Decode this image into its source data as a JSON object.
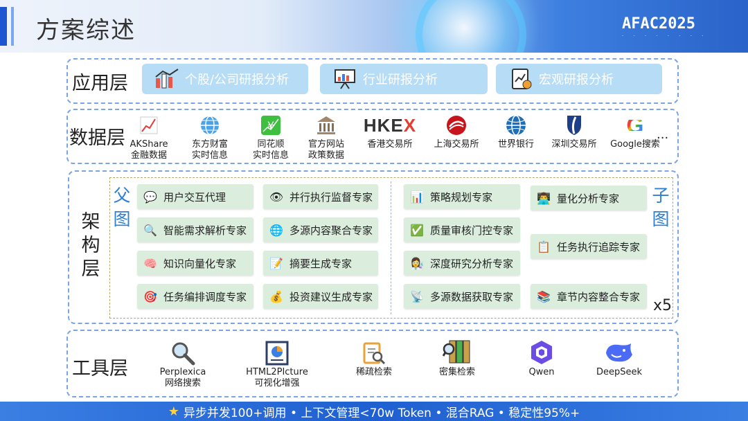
{
  "header": {
    "title": "方案综述",
    "logo": "AFAC2025"
  },
  "app_layer": {
    "label": "应用层",
    "items": [
      {
        "label": "个股/公司研报分析",
        "icon": "chart-building-icon"
      },
      {
        "label": "行业研报分析",
        "icon": "presentation-board-icon"
      },
      {
        "label": "宏观研报分析",
        "icon": "macro-report-icon"
      }
    ]
  },
  "data_layer": {
    "label": "数据层",
    "sources": [
      {
        "line1": "AKShare",
        "line2": "金融数据",
        "icon": "line-chart-icon"
      },
      {
        "line1": "东方财富",
        "line2": "实时信息",
        "icon": "globe-icon"
      },
      {
        "line1": "同花顺",
        "line2": "实时信息",
        "icon": "yen-chart-icon"
      },
      {
        "line1": "官方网站",
        "line2": "政策数据",
        "icon": "bank-building-icon"
      },
      {
        "line1": "香港交易所",
        "line2": "",
        "logo_text": "HKE",
        "logo_x": "X",
        "icon": "hkex-logo"
      },
      {
        "line1": "上海交易所",
        "line2": "",
        "icon": "sse-logo"
      },
      {
        "line1": "世界银行",
        "line2": "",
        "icon": "world-bank-logo"
      },
      {
        "line1": "深圳交易所",
        "line2": "",
        "icon": "szse-logo"
      },
      {
        "line1": "Google搜索",
        "line2": "",
        "logo_text": "G",
        "icon": "google-logo"
      }
    ],
    "more": "..."
  },
  "arch_layer": {
    "label_chars": [
      "架",
      "构",
      "层"
    ],
    "parent_chars": [
      "父",
      "图"
    ],
    "child_chars": [
      "子",
      "图"
    ],
    "multiplier": "x5",
    "parent_agents": [
      {
        "label": "用户交互代理",
        "icon": "speech-bubble-icon"
      },
      {
        "label": "并行执行监督专家",
        "icon": "eye-icon"
      },
      {
        "label": "智能需求解析专家",
        "icon": "magnifier-icon"
      },
      {
        "label": "多源内容聚合专家",
        "icon": "globe-icon"
      },
      {
        "label": "知识向量化专家",
        "icon": "brain-icon"
      },
      {
        "label": "摘要生成专家",
        "icon": "memo-icon"
      },
      {
        "label": "任务编排调度专家",
        "icon": "target-icon"
      },
      {
        "label": "投资建议生成专家",
        "icon": "money-bag-icon"
      }
    ],
    "child_agents": [
      {
        "label": "策略规划专家",
        "icon": "bar-chart-icon"
      },
      {
        "label": "量化分析专家",
        "icon": "technologist-icon"
      },
      {
        "label": "质量审核门控专家",
        "icon": "check-mark-icon"
      },
      {
        "label": "任务执行追踪专家",
        "icon": "clipboard-icon"
      },
      {
        "label": "深度研究分析专家",
        "icon": "scientist-icon"
      },
      {
        "label": "多源数据获取专家",
        "icon": "satellite-icon"
      },
      {
        "label": "章节内容整合专家",
        "icon": "books-icon"
      }
    ]
  },
  "tool_layer": {
    "label": "工具层",
    "tools": [
      {
        "line1": "Perplexica",
        "line2": "网络搜索",
        "icon": "magnifier-icon"
      },
      {
        "line1": "HTML2PIcture",
        "line2": "可视化增强",
        "icon": "pie-document-icon"
      },
      {
        "line1": "稀疏检索",
        "line2": "",
        "icon": "document-search-icon"
      },
      {
        "line1": "密集检索",
        "line2": "",
        "icon": "binder-search-icon"
      },
      {
        "line1": "Qwen",
        "line2": "",
        "icon": "qwen-logo"
      },
      {
        "line1": "DeepSeek",
        "line2": "",
        "icon": "deepseek-whale-logo"
      }
    ]
  },
  "footer": {
    "text": "异步并发100+调用 • 上下文管理<70w Token • 混合RAG • 稳定性95%+",
    "icon": "star-icon"
  },
  "colors": {
    "accent": "#1e55d0",
    "app_box": "#b6dcf6",
    "agent_box": "#dbeedd",
    "side_char": "#2f7fd6",
    "border": "#7ba4e3"
  }
}
